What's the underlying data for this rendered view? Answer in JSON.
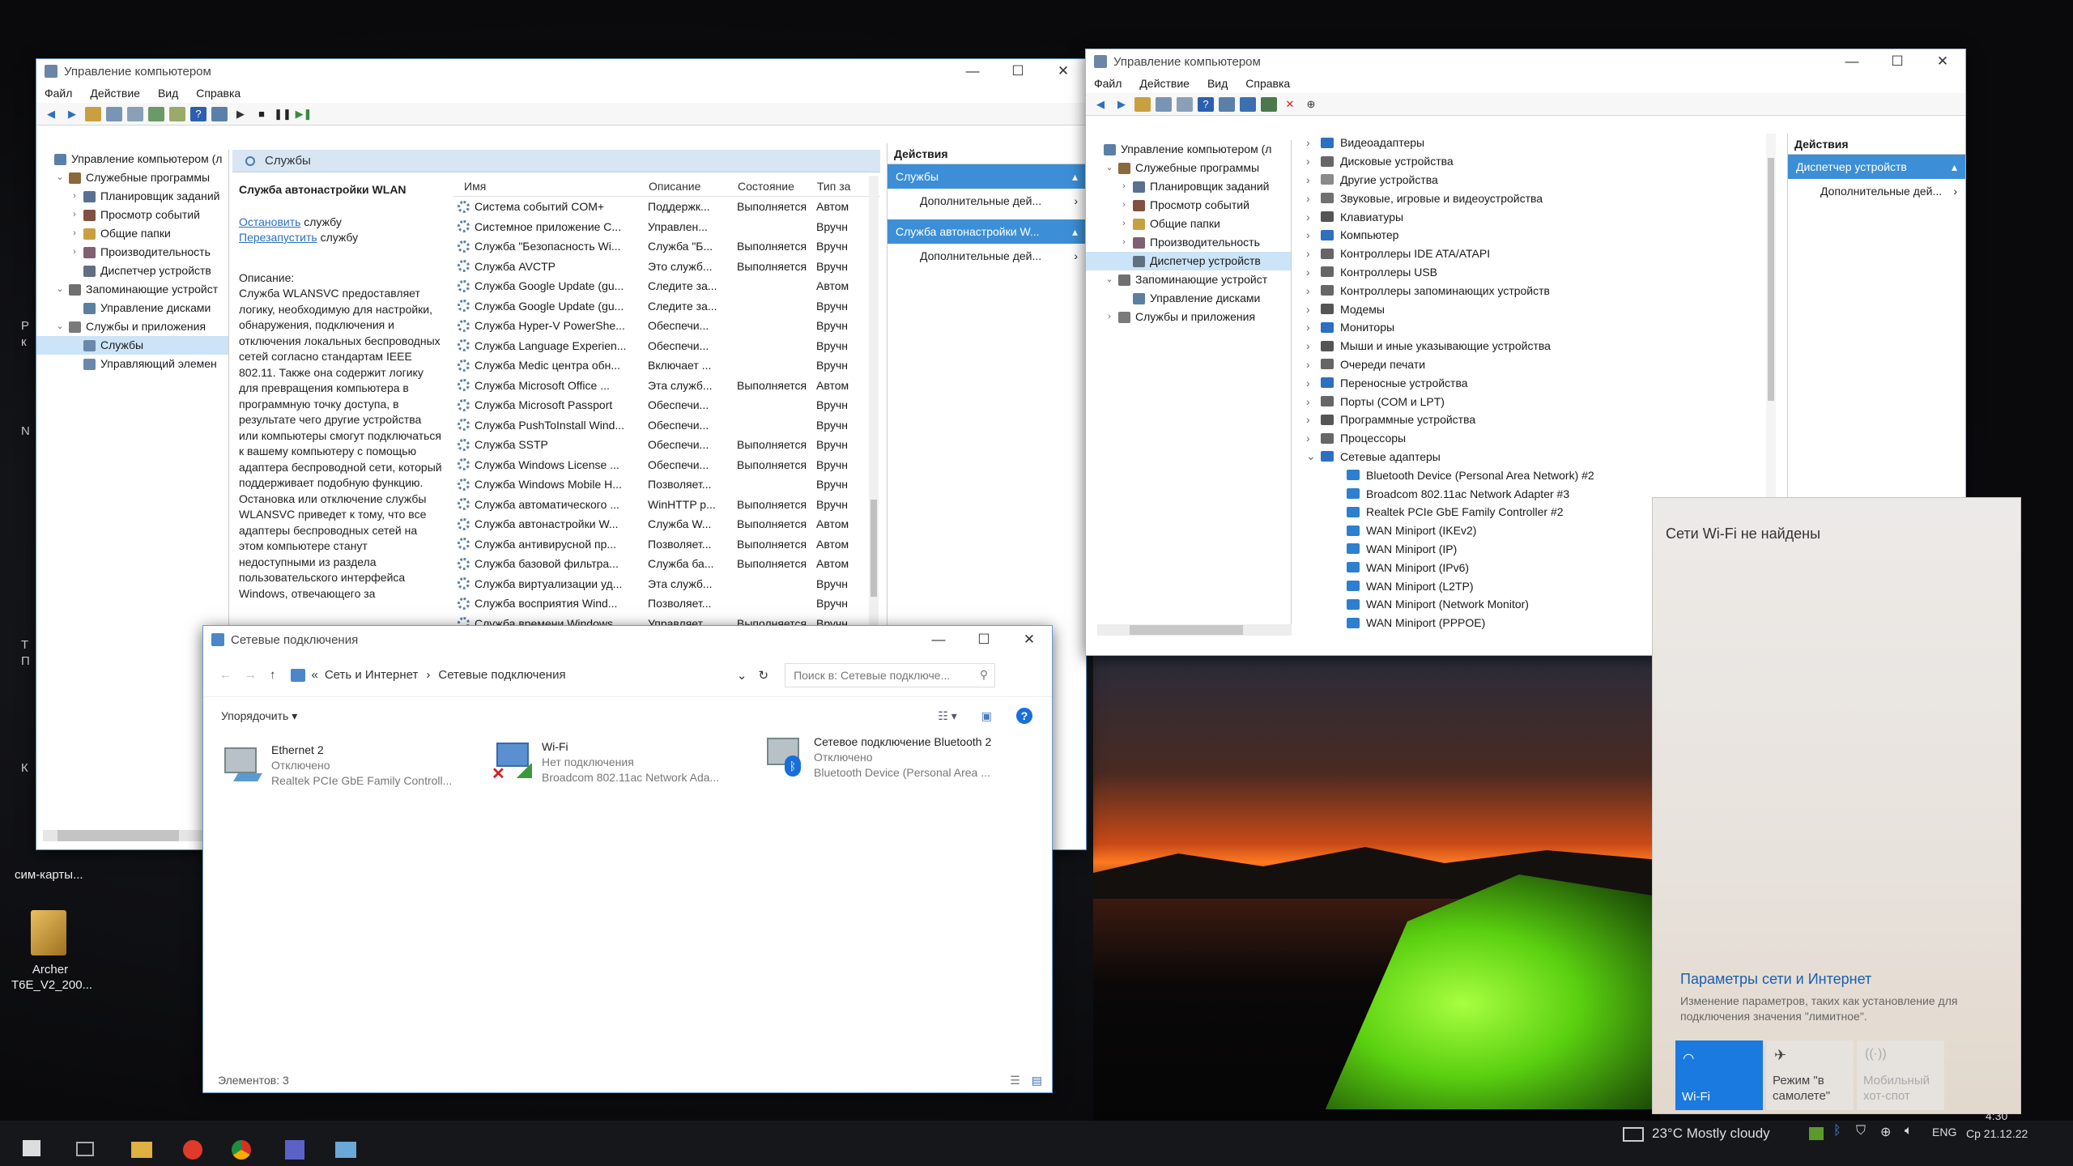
{
  "desktop": {
    "left_label_1": "Р",
    "left_label_2": "к",
    "left_label_3": "N",
    "left_label_4": "Т",
    "left_label_5": "П",
    "left_label_6": "К",
    "sim_label": "сим-карты...",
    "archer_label": "Archer T6E_V2_200..."
  },
  "win1": {
    "title": "Управление компьютером",
    "menu": [
      "Файл",
      "Действие",
      "Вид",
      "Справка"
    ],
    "tree": [
      {
        "label": "Управление компьютером (л",
        "indent": 0,
        "exp": "",
        "color": "#5b7fa8"
      },
      {
        "label": "Служебные программы",
        "indent": 1,
        "exp": "⌄",
        "color": "#8a6a3a"
      },
      {
        "label": "Планировщик заданий",
        "indent": 2,
        "exp": "›",
        "color": "#5a7090"
      },
      {
        "label": "Просмотр событий",
        "indent": 2,
        "exp": "›",
        "color": "#805040"
      },
      {
        "label": "Общие папки",
        "indent": 2,
        "exp": "›",
        "color": "#c8a040"
      },
      {
        "label": "Производительность",
        "indent": 2,
        "exp": "›",
        "color": "#806070"
      },
      {
        "label": "Диспетчер устройств",
        "indent": 2,
        "exp": "",
        "color": "#607080"
      },
      {
        "label": "Запоминающие устройст",
        "indent": 1,
        "exp": "⌄",
        "color": "#707070"
      },
      {
        "label": "Управление дисками",
        "indent": 2,
        "exp": "",
        "color": "#5a7fa0"
      },
      {
        "label": "Службы и приложения",
        "indent": 1,
        "exp": "⌄",
        "color": "#7a7a7a"
      },
      {
        "label": "Службы",
        "indent": 2,
        "exp": "",
        "color": "#6a88aa",
        "selected": true
      },
      {
        "label": "Управляющий элемен",
        "indent": 2,
        "exp": "",
        "color": "#6a88aa"
      }
    ],
    "services_header": "Службы",
    "detail": {
      "title": "Служба автонастройки WLAN",
      "stop_link": "Остановить",
      "stop_rest": " службу",
      "restart_link": "Перезапустить",
      "restart_rest": " службу",
      "desc_label": "Описание:",
      "desc": "Служба WLANSVC предоставляет логику, необходимую для настройки, обнаружения, подключения и отключения локальных беспроводных сетей согласно стандартам IEEE 802.11. Также она содержит логику для превращения компьютера в программную точку доступа, в результате чего другие устройства или компьютеры смогут подключаться к вашему компьютеру с помощью адаптера беспроводной сети, который поддерживает подобную функцию. Остановка или отключение службы WLANSVC приведет к тому, что все адаптеры беспроводных сетей на этом компьютере станут недоступными из раздела пользовательского интерфейса Windows, отвечающего за"
    },
    "columns": [
      "Имя",
      "Описание",
      "Состояние",
      "Тип за"
    ],
    "services": [
      {
        "name": "Система событий COM+",
        "desc": "Поддержк...",
        "state": "Выполняется",
        "type": "Автом"
      },
      {
        "name": "Системное приложение С...",
        "desc": "Управлен...",
        "state": "",
        "type": "Вручн"
      },
      {
        "name": "Служба \"Безопасность Wi...",
        "desc": "Служба \"Б...",
        "state": "Выполняется",
        "type": "Вручн"
      },
      {
        "name": "Служба AVCTP",
        "desc": "Это служб...",
        "state": "Выполняется",
        "type": "Вручн"
      },
      {
        "name": "Служба Google Update (gu...",
        "desc": "Следите за...",
        "state": "",
        "type": "Автом"
      },
      {
        "name": "Служба Google Update (gu...",
        "desc": "Следите за...",
        "state": "",
        "type": "Вручн"
      },
      {
        "name": "Служба Hyper-V PowerShe...",
        "desc": "Обеспечи...",
        "state": "",
        "type": "Вручн"
      },
      {
        "name": "Служба Language Experien...",
        "desc": "Обеспечи...",
        "state": "",
        "type": "Вручн"
      },
      {
        "name": "Служба Medic центра обн...",
        "desc": "Включает ...",
        "state": "",
        "type": "Вручн"
      },
      {
        "name": "Служба Microsoft Office ...",
        "desc": "Эта служб...",
        "state": "Выполняется",
        "type": "Автом"
      },
      {
        "name": "Служба Microsoft Passport",
        "desc": "Обеспечи...",
        "state": "",
        "type": "Вручн"
      },
      {
        "name": "Служба PushToInstall Wind...",
        "desc": "Обеспечи...",
        "state": "",
        "type": "Вручн"
      },
      {
        "name": "Служба SSTP",
        "desc": "Обеспечи...",
        "state": "Выполняется",
        "type": "Вручн"
      },
      {
        "name": "Служба Windows License ...",
        "desc": "Обеспечи...",
        "state": "Выполняется",
        "type": "Вручн"
      },
      {
        "name": "Служба Windows Mobile H...",
        "desc": "Позволяет...",
        "state": "",
        "type": "Вручн"
      },
      {
        "name": "Служба автоматического ...",
        "desc": "WinHTTP р...",
        "state": "Выполняется",
        "type": "Вручн"
      },
      {
        "name": "Служба автонастройки W...",
        "desc": "Служба W...",
        "state": "Выполняется",
        "type": "Автом"
      },
      {
        "name": "Служба антивирусной пр...",
        "desc": "Позволяет...",
        "state": "Выполняется",
        "type": "Автом"
      },
      {
        "name": "Служба базовой фильтра...",
        "desc": "Служба ба...",
        "state": "Выполняется",
        "type": "Автом"
      },
      {
        "name": "Служба виртуализации уд...",
        "desc": "Эта служб...",
        "state": "",
        "type": "Вручн"
      },
      {
        "name": "Служба восприятия Wind...",
        "desc": "Позволяет...",
        "state": "",
        "type": "Вручн"
      },
      {
        "name": "Служба времени Windows",
        "desc": "Управляет...",
        "state": "Выполняется",
        "type": "Вручн"
      }
    ],
    "actions": {
      "header": "Действия",
      "group1": "Службы",
      "more1": "Дополнительные дей...",
      "group2": "Служба автонастройки W...",
      "more2": "Дополнительные дей..."
    }
  },
  "win2": {
    "title": "Управление компьютером",
    "menu": [
      "Файл",
      "Действие",
      "Вид",
      "Справка"
    ],
    "tree": [
      {
        "label": "Управление компьютером (л",
        "indent": 0,
        "exp": "",
        "color": "#5b7fa8"
      },
      {
        "label": "Служебные программы",
        "indent": 1,
        "exp": "⌄",
        "color": "#8a6a3a"
      },
      {
        "label": "Планировщик заданий",
        "indent": 2,
        "exp": "›",
        "color": "#5a7090"
      },
      {
        "label": "Просмотр событий",
        "indent": 2,
        "exp": "›",
        "color": "#805040"
      },
      {
        "label": "Общие папки",
        "indent": 2,
        "exp": "›",
        "color": "#c8a040"
      },
      {
        "label": "Производительность",
        "indent": 2,
        "exp": "›",
        "color": "#806070"
      },
      {
        "label": "Диспетчер устройств",
        "indent": 2,
        "exp": "",
        "color": "#607080",
        "selected": true
      },
      {
        "label": "Запоминающие устройст",
        "indent": 1,
        "exp": "⌄",
        "color": "#707070"
      },
      {
        "label": "Управление дисками",
        "indent": 2,
        "exp": "",
        "color": "#5a7fa0"
      },
      {
        "label": "Службы и приложения",
        "indent": 1,
        "exp": "›",
        "color": "#7a7a7a"
      }
    ],
    "devices": [
      {
        "label": "Видеоадаптеры",
        "child": false,
        "exp": "›",
        "color": "#2d6fc0"
      },
      {
        "label": "Дисковые устройства",
        "child": false,
        "exp": "›",
        "color": "#666"
      },
      {
        "label": "Другие устройства",
        "child": false,
        "exp": "›",
        "color": "#8a8a8a"
      },
      {
        "label": "Звуковые, игровые и видеоустройства",
        "child": false,
        "exp": "›",
        "color": "#707070"
      },
      {
        "label": "Клавиатуры",
        "child": false,
        "exp": "›",
        "color": "#555"
      },
      {
        "label": "Компьютер",
        "child": false,
        "exp": "›",
        "color": "#2d6fc0"
      },
      {
        "label": "Контроллеры IDE ATA/ATAPI",
        "child": false,
        "exp": "›",
        "color": "#666"
      },
      {
        "label": "Контроллеры USB",
        "child": false,
        "exp": "›",
        "color": "#666"
      },
      {
        "label": "Контроллеры запоминающих устройств",
        "child": false,
        "exp": "›",
        "color": "#666"
      },
      {
        "label": "Модемы",
        "child": false,
        "exp": "›",
        "color": "#555"
      },
      {
        "label": "Мониторы",
        "child": false,
        "exp": "›",
        "color": "#2d6fc0"
      },
      {
        "label": "Мыши и иные указывающие устройства",
        "child": false,
        "exp": "›",
        "color": "#555"
      },
      {
        "label": "Очереди печати",
        "child": false,
        "exp": "›",
        "color": "#666"
      },
      {
        "label": "Переносные устройства",
        "child": false,
        "exp": "›",
        "color": "#2d6fc0"
      },
      {
        "label": "Порты (COM и LPT)",
        "child": false,
        "exp": "›",
        "color": "#666"
      },
      {
        "label": "Программные устройства",
        "child": false,
        "exp": "›",
        "color": "#555"
      },
      {
        "label": "Процессоры",
        "child": false,
        "exp": "›",
        "color": "#666"
      },
      {
        "label": "Сетевые адаптеры",
        "child": false,
        "exp": "⌄",
        "color": "#2d6fc0"
      },
      {
        "label": "Bluetooth Device (Personal Area Network) #2",
        "child": true,
        "exp": "",
        "color": "#2d7fd0"
      },
      {
        "label": "Broadcom 802.11ac Network Adapter #3",
        "child": true,
        "exp": "",
        "color": "#2d7fd0"
      },
      {
        "label": "Realtek PCIe GbE Family Controller #2",
        "child": true,
        "exp": "",
        "color": "#2d7fd0"
      },
      {
        "label": "WAN Miniport (IKEv2)",
        "child": true,
        "exp": "",
        "color": "#2d7fd0"
      },
      {
        "label": "WAN Miniport (IP)",
        "child": true,
        "exp": "",
        "color": "#2d7fd0"
      },
      {
        "label": "WAN Miniport (IPv6)",
        "child": true,
        "exp": "",
        "color": "#2d7fd0"
      },
      {
        "label": "WAN Miniport (L2TP)",
        "child": true,
        "exp": "",
        "color": "#2d7fd0"
      },
      {
        "label": "WAN Miniport (Network Monitor)",
        "child": true,
        "exp": "",
        "color": "#2d7fd0"
      },
      {
        "label": "WAN Miniport (PPPOE)",
        "child": true,
        "exp": "",
        "color": "#2d7fd0"
      }
    ],
    "actions": {
      "header": "Действия",
      "group1": "Диспетчер устройств",
      "more1": "Дополнительные дей..."
    }
  },
  "win3": {
    "title": "Сетевые подключения",
    "breadcrumb_prefix": "«",
    "crumb1": "Сеть и Интернет",
    "crumb_sep": "›",
    "crumb2": "Сетевые подключения",
    "search_placeholder": "Поиск в: Сетевые подключе...",
    "organize": "Упорядочить",
    "status": "Элементов: 3",
    "connections": [
      {
        "name": "Ethernet 2",
        "state": "Отключено",
        "adapter": "Realtek PCIe GbE Family Controll..."
      },
      {
        "name": "Wi-Fi",
        "state": "Нет подключения",
        "adapter": "Broadcom 802.11ac Network Ada..."
      },
      {
        "name": "Сетевое подключение Bluetooth 2",
        "state": "Отключено",
        "adapter": "Bluetooth Device (Personal Area ..."
      }
    ]
  },
  "flyout": {
    "no_wifi": "Сети Wi-Fi не найдены",
    "settings_link": "Параметры сети и Интернет",
    "settings_desc": "Изменение параметров, таких как установление для подключения значения \"лимитное\".",
    "tiles": [
      {
        "label": "Wi-Fi",
        "active": true
      },
      {
        "label": "Режим \"в самолете\"",
        "active": false
      },
      {
        "label": "Мобильный хот-спот",
        "active": false
      }
    ]
  },
  "taskbar": {
    "weather": "23°C  Mostly cloudy",
    "lang": "ENG",
    "time": "4:30",
    "date": "Ср 21.12.22"
  },
  "colors": {
    "accent": "#3c8fd6",
    "link": "#2b6fbf"
  }
}
